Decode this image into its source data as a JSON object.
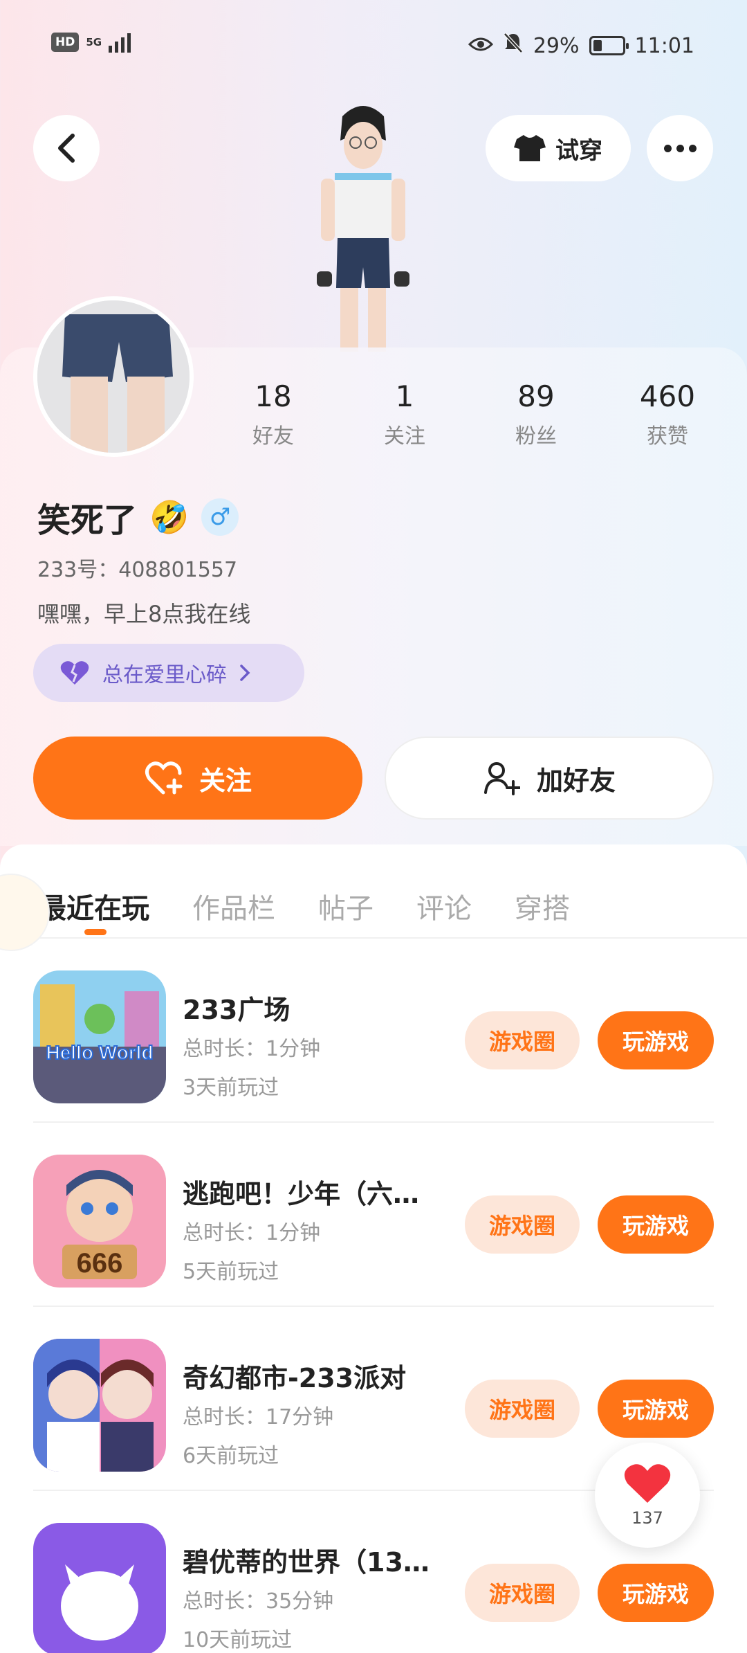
{
  "status_bar": {
    "hd": "HD",
    "network": "5G",
    "battery_text": "29%",
    "time": "11:01"
  },
  "header": {
    "try_on_label": "试穿"
  },
  "profile": {
    "stats": [
      {
        "value": "18",
        "label": "好友"
      },
      {
        "value": "1",
        "label": "关注"
      },
      {
        "value": "89",
        "label": "粉丝"
      },
      {
        "value": "460",
        "label": "获赞"
      }
    ],
    "username": "笑死了",
    "username_emoji": "🤣",
    "gender_symbol": "♂",
    "user_id": "233号：408801557",
    "bio": "嘿嘿，早上8点我在线",
    "tag_label": "总在爱里心碎",
    "follow_label": "关注",
    "add_friend_label": "加好友"
  },
  "tabs": [
    {
      "label": "最近在玩",
      "active": true
    },
    {
      "label": "作品栏",
      "active": false
    },
    {
      "label": "帖子",
      "active": false
    },
    {
      "label": "评论",
      "active": false
    },
    {
      "label": "穿搭",
      "active": false
    }
  ],
  "games": [
    {
      "title": "233广场",
      "duration": "总时长：1分钟",
      "last_played": "3天前玩过",
      "circle_label": "游戏圈",
      "play_label": "玩游戏",
      "icon_text": "Hello World"
    },
    {
      "title": "逃跑吧！少年（六…",
      "duration": "总时长：1分钟",
      "last_played": "5天前玩过",
      "circle_label": "游戏圈",
      "play_label": "玩游戏",
      "icon_text": "666"
    },
    {
      "title": "奇幻都市-233派对",
      "duration": "总时长：17分钟",
      "last_played": "6天前玩过",
      "circle_label": "游戏圈",
      "play_label": "玩游戏",
      "icon_text": ""
    },
    {
      "title": "碧优蒂的世界（13…",
      "duration": "总时长：35分钟",
      "last_played": "10天前玩过",
      "circle_label": "游戏圈",
      "play_label": "玩游戏",
      "icon_text": ""
    }
  ],
  "like_float": {
    "count": "137"
  },
  "colors": {
    "accent": "#ff7417",
    "tag_purple": "#6a5ac9"
  }
}
